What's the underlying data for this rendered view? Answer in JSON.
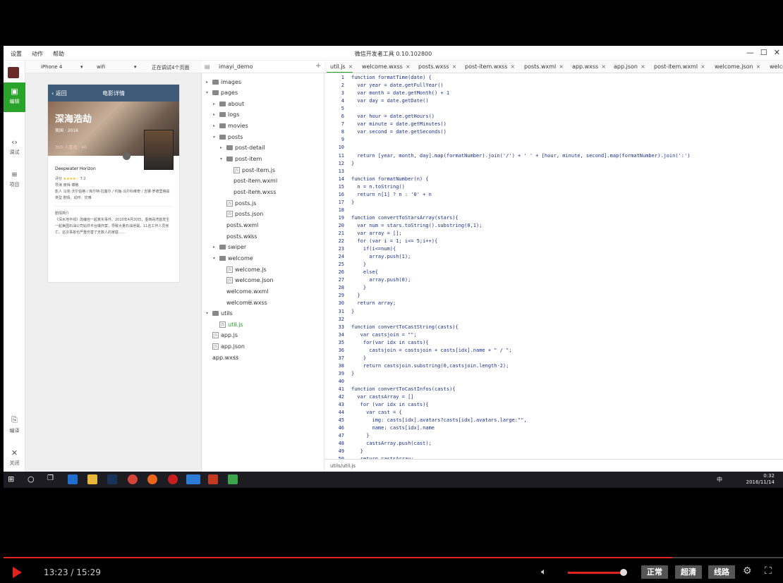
{
  "window": {
    "menu": [
      "设置",
      "动作",
      "帮助"
    ],
    "title": "微信开发者工具 0.10.102800"
  },
  "rail": [
    {
      "label": "编辑",
      "icon": "edit-icon",
      "active": true
    },
    {
      "label": "调试",
      "icon": "code-icon",
      "active": false
    },
    {
      "label": "项目",
      "icon": "list-icon",
      "active": false
    },
    {
      "label": "编译",
      "icon": "compile-icon",
      "active": false
    },
    {
      "label": "关闭",
      "icon": "close-icon",
      "active": false
    }
  ],
  "simulator": {
    "device": "iPhone 4",
    "network": "wifi",
    "status": "正在调试4个页面",
    "phone": {
      "nav_back": "返回",
      "nav_title": "电影详情",
      "movie_title": "深海浩劫",
      "meta": "美国 · 2016",
      "counts": "365 人喜欢 · 40",
      "original_title": "Deepwater Horizon",
      "rating_label": "评分",
      "rating": "7.2",
      "director_label": "导演",
      "director": "彼得·博格",
      "cast_label": "影人",
      "cast": "马克·沃尔伯格 / 库尔特·拉塞尔 / 约翰·马尔科维奇 / 吉娜·罗德里格兹",
      "genre_label": "类型",
      "genre": "剧情、动作、灾难",
      "summary_label": "剧情简介",
      "summary": "《深水地平线》改编自一起真实事件。2010年4月20日，墨西哥湾首发生一起美国石油公司钻井平台爆炸案，导致大量石油泄漏，11名工作人员身亡。这次事故也严重伤害了无数人的家庭……"
    }
  },
  "tree": {
    "project": "imayi_demo",
    "nodes": [
      {
        "label": "images",
        "kind": "folder",
        "depth": 0,
        "open": false
      },
      {
        "label": "pages",
        "kind": "folder",
        "depth": 0,
        "open": true
      },
      {
        "label": "about",
        "kind": "folder",
        "depth": 1,
        "open": false
      },
      {
        "label": "logs",
        "kind": "folder",
        "depth": 1,
        "open": false
      },
      {
        "label": "movies",
        "kind": "folder",
        "depth": 1,
        "open": false
      },
      {
        "label": "posts",
        "kind": "folder",
        "depth": 1,
        "open": true
      },
      {
        "label": "post-detail",
        "kind": "folder",
        "depth": 2,
        "open": false
      },
      {
        "label": "post-item",
        "kind": "folder",
        "depth": 2,
        "open": true
      },
      {
        "label": "post-item.js",
        "kind": "js",
        "depth": 3
      },
      {
        "label": "post-item.wxml",
        "kind": "code",
        "depth": 3
      },
      {
        "label": "post-item.wxss",
        "kind": "brace",
        "depth": 3
      },
      {
        "label": "posts.js",
        "kind": "js",
        "depth": 2
      },
      {
        "label": "posts.json",
        "kind": "js",
        "depth": 2
      },
      {
        "label": "posts.wxml",
        "kind": "code",
        "depth": 2
      },
      {
        "label": "posts.wxss",
        "kind": "brace",
        "depth": 2
      },
      {
        "label": "swiper",
        "kind": "folder",
        "depth": 1,
        "open": false
      },
      {
        "label": "welcome",
        "kind": "folder",
        "depth": 1,
        "open": true
      },
      {
        "label": "welcome.js",
        "kind": "js",
        "depth": 2
      },
      {
        "label": "welcome.json",
        "kind": "js",
        "depth": 2
      },
      {
        "label": "welcome.wxml",
        "kind": "code",
        "depth": 2
      },
      {
        "label": "welcome.wxss",
        "kind": "brace",
        "depth": 2
      },
      {
        "label": "utils",
        "kind": "folder",
        "depth": 0,
        "open": true
      },
      {
        "label": "util.js",
        "kind": "js",
        "depth": 1,
        "selected": true
      },
      {
        "label": "app.js",
        "kind": "js",
        "depth": 0
      },
      {
        "label": "app.json",
        "kind": "js",
        "depth": 0
      },
      {
        "label": "app.wxss",
        "kind": "brace",
        "depth": 0
      }
    ]
  },
  "tabs": [
    "util.js",
    "welcome.wxss",
    "posts.wxss",
    "post-item.wxss",
    "posts.wxml",
    "app.wxss",
    "app.json",
    "post-item.wxml",
    "welcome.json",
    "welco"
  ],
  "code_lines": [
    "function formatTime(date) {",
    "  var year = date.getFullYear()",
    "  var month = date.getMonth() + 1",
    "  var day = date.getDate()",
    "",
    "  var hour = date.getHours()",
    "  var minute = date.getMinutes()",
    "  var second = date.getSeconds()",
    "",
    "",
    "  return [year, month, day].map(formatNumber).join('/') + ' ' + [hour, minute, second].map(formatNumber).join(':')",
    "}",
    "",
    "function formatNumber(n) {",
    "  n = n.toString()",
    "  return n[1] ? n : '0' + n",
    "}",
    "",
    "function convertToStarsArray(stars){",
    "  var num = stars.toString().substring(0,1);",
    "  var array = [];",
    "  for (var i = 1; i<= 5;i++){",
    "    if(i<=num){",
    "      array.push(1);",
    "    }",
    "    else{",
    "      array.push(0);",
    "    }",
    "  }",
    "  return array;",
    "}",
    "",
    "function convertToCastString(casts){",
    "   var castsjoin = \"\";",
    "    for(var idx in casts){",
    "      castsjoin = castsjoin + casts[idx].name + \" / \";",
    "    }",
    "    return castsjoin.substring(0,castsjoin.length-2);",
    "}",
    "",
    "function convertToCastInfos(casts){",
    "  var castsArray = []",
    "   for (var idx in casts){",
    "     var cast = {",
    "       img: casts[idx].avatars?casts[idx].avatars.large:\"\",",
    "       name: casts[idx].name",
    "     }",
    "     castsArray.push(cast);",
    "   }",
    "   return castsArray;"
  ],
  "status_path": "utils/util.js",
  "taskbar": {
    "time": "0:32",
    "date": "2016/11/14",
    "tray": "中"
  },
  "player": {
    "time": "13:23 / 15:29",
    "progress": 0.858,
    "volume": 0.95,
    "buttons": [
      "正常",
      "超清",
      "线路"
    ]
  }
}
